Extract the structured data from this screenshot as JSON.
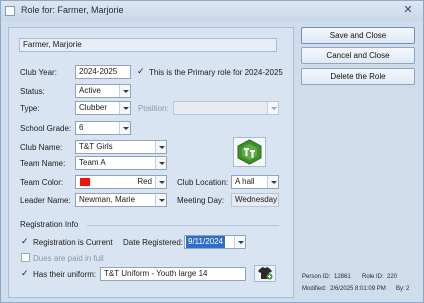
{
  "window": {
    "title": "Role for: Farmer, Marjorie",
    "close_glyph": "✕"
  },
  "person": {
    "name": "Farmer, Marjorie"
  },
  "fields": {
    "club_year": {
      "label": "Club Year:",
      "value": "2024-2025"
    },
    "primary_role": {
      "label": "This is the Primary role for 2024-2025",
      "checked": true
    },
    "status": {
      "label": "Status:",
      "value": "Active"
    },
    "type": {
      "label": "Type:",
      "value": "Clubber"
    },
    "position": {
      "label": "Position:",
      "value": ""
    },
    "school_grade": {
      "label": "School Grade:",
      "value": "6"
    },
    "club_name": {
      "label": "Club Name:",
      "value": "T&T Girls"
    },
    "team_name": {
      "label": "Team Name:",
      "value": "Team A"
    },
    "team_color": {
      "label": "Team Color:",
      "value": "Red",
      "swatch": "#ee1111"
    },
    "club_location": {
      "label": "Club Location:",
      "value": "A hall"
    },
    "leader_name": {
      "label": "Leader Name:",
      "value": "Newman, Marie"
    },
    "meeting_day": {
      "label": "Meeting Day:",
      "value": "Wednesday"
    }
  },
  "registration": {
    "section_label": "Registration Info",
    "is_current": {
      "label": "Registration is Current",
      "checked": true
    },
    "date_registered": {
      "label": "Date Registered:",
      "value": "9/11/2024"
    },
    "dues_paid": {
      "label": "Dues are paid in full",
      "checked": false
    },
    "uniform": {
      "label": "Has their uniform:",
      "checked": true,
      "value": "T&T Uniform - Youth large 14"
    }
  },
  "buttons": {
    "save_close": "Save and Close",
    "cancel_close": "Cancel and Close",
    "delete_role": "Delete the Role"
  },
  "footer": {
    "person_id_label": "Person ID:",
    "person_id": "12861",
    "role_id_label": "Role ID:",
    "role_id": "220",
    "modified_label": "Modified:",
    "modified": "2/6/2025 8:01:09 PM",
    "by_label": "By:",
    "by": "2"
  },
  "colors": {
    "accent": "#3f8f2f",
    "selection": "#2f6fc6"
  },
  "icons": {
    "logo": "tt-logo-icon",
    "uniform": "tshirt-icon"
  }
}
